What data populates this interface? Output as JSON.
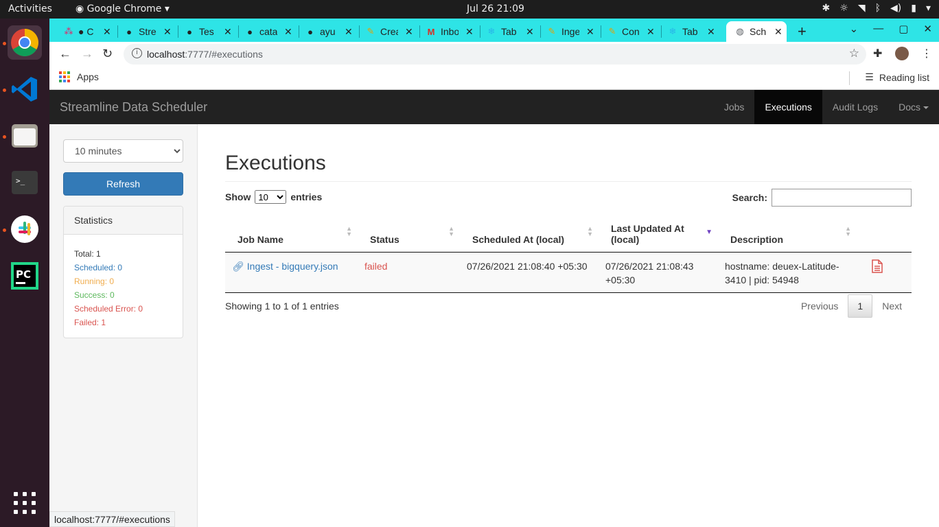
{
  "topbar": {
    "activities": "Activities",
    "app": "Google Chrome",
    "clock": "Jul 26  21:09"
  },
  "dock": {
    "apps": [
      "chrome-icon",
      "vscode-icon",
      "files-icon",
      "terminal-icon",
      "slack-icon",
      "pycharm-icon"
    ]
  },
  "tabs": [
    {
      "label": "● C",
      "icon": "app-icon"
    },
    {
      "label": "Stre",
      "icon": "github-icon"
    },
    {
      "label": "Tes",
      "icon": "github-icon"
    },
    {
      "label": "cata",
      "icon": "github-icon"
    },
    {
      "label": "ayu",
      "icon": "github-icon"
    },
    {
      "label": "Crea",
      "icon": "pencil-icon"
    },
    {
      "label": "Inbo",
      "icon": "gmail-icon"
    },
    {
      "label": "Tab",
      "icon": "snowflake-icon"
    },
    {
      "label": "Inge",
      "icon": "pencil-icon"
    },
    {
      "label": "Con",
      "icon": "pencil-icon"
    },
    {
      "label": "Tab",
      "icon": "snowflake-icon"
    },
    {
      "label": "Sch",
      "icon": "globe-icon",
      "active": true
    }
  ],
  "address": {
    "host": "localhost",
    "rest": ":7777/#executions"
  },
  "bookmarks": {
    "apps": "Apps",
    "reading_list": "Reading list"
  },
  "app": {
    "brand": "Streamline Data Scheduler",
    "nav": [
      "Jobs",
      "Executions",
      "Audit Logs",
      "Docs"
    ],
    "active_nav": "Executions"
  },
  "sidebar": {
    "interval": "10 minutes",
    "refresh": "Refresh",
    "stats_title": "Statistics",
    "stats": {
      "total": "Total: 1",
      "scheduled": "Scheduled: 0",
      "running": "Running: 0",
      "success": "Success: 0",
      "scheduled_error": "Scheduled Error: 0",
      "failed": "Failed: 1"
    },
    "colors": {
      "scheduled": "#337ab7",
      "running": "#f0ad4e",
      "success": "#5cb85c",
      "error": "#d9534f"
    }
  },
  "main": {
    "title": "Executions",
    "show_prefix": "Show",
    "show_value": "10",
    "show_suffix": "entries",
    "search_label": "Search:",
    "columns": [
      "Job Name",
      "Status",
      "Scheduled At (local)",
      "Last Updated At (local)",
      "Description"
    ],
    "rows": [
      {
        "job_name": "Ingest - bigquery.json",
        "status": "failed",
        "scheduled_at": "07/26/2021 21:08:40 +05:30",
        "updated_at": "07/26/2021 21:08:43 +05:30",
        "description": "hostname: deuex-Latitude-3410 | pid: 54948"
      }
    ],
    "showing": "Showing 1 to 1 of 1 entries",
    "pager": {
      "prev": "Previous",
      "page": "1",
      "next": "Next"
    }
  },
  "status_url": "localhost:7777/#executions"
}
